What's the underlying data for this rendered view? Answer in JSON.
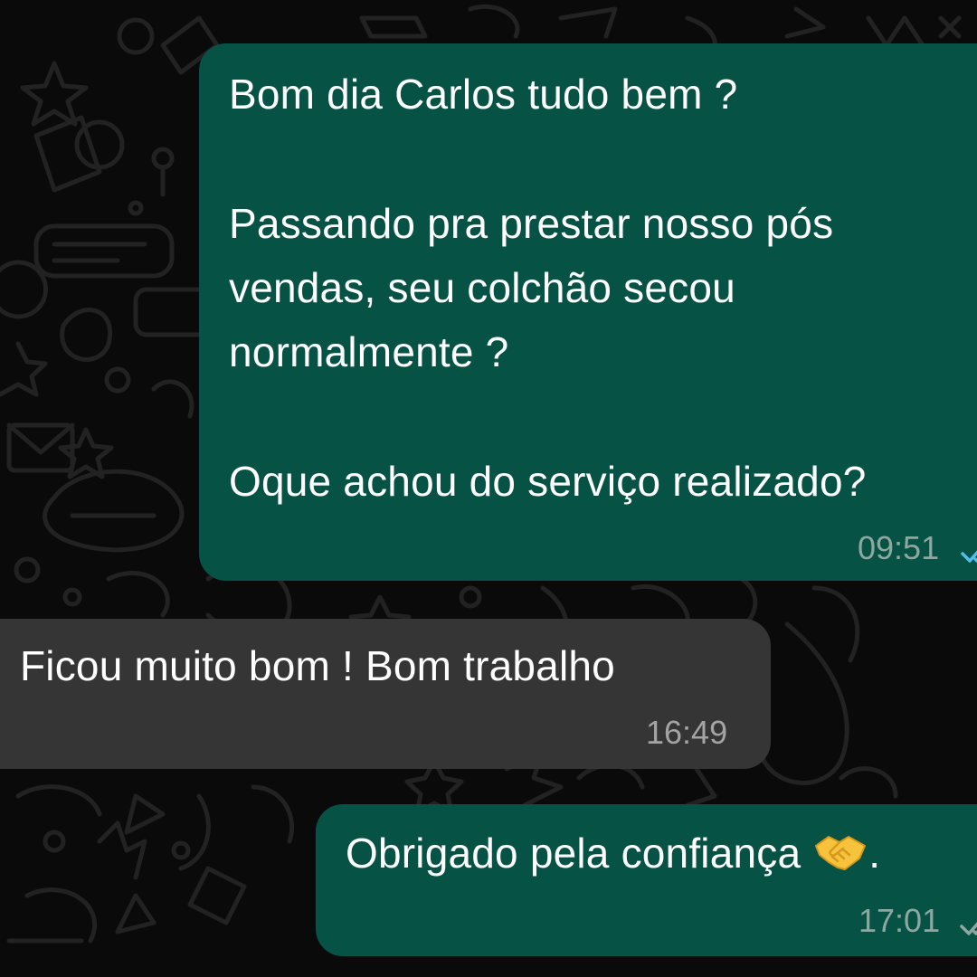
{
  "messages": [
    {
      "direction": "outgoing",
      "lines": [
        "Bom dia Carlos tudo bem ?",
        "",
        "Passando pra prestar nosso pós",
        "vendas, seu colchão secou",
        "normalmente ?",
        "",
        "Oque achou do serviço realizado?"
      ],
      "time": "09:51",
      "status_icon": "double-check-icon",
      "status_color": "#53bdeb"
    },
    {
      "direction": "incoming",
      "lines": [
        "Ficou muito bom ! Bom trabalho"
      ],
      "time": "16:49"
    },
    {
      "direction": "outgoing",
      "text": "Obrigado pela confiança",
      "emoji": "handshake-icon",
      "trailing": ".",
      "time": "17:01",
      "status_icon": "double-check-icon",
      "status_color": "#8ea7a1"
    }
  ],
  "colors": {
    "outgoing_bubble": "#065245",
    "incoming_bubble": "#353535",
    "background": "#0a0a0a",
    "wallpaper_doodle": "#1f1f1f"
  }
}
